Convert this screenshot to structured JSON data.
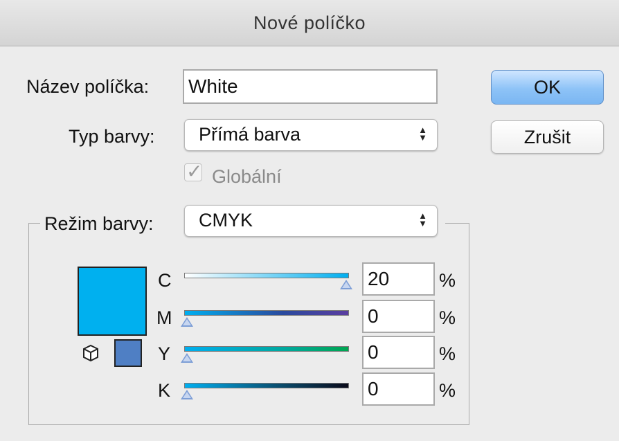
{
  "window": {
    "title": "Nové políčko"
  },
  "name_field": {
    "label": "Název políčka:",
    "value": "White"
  },
  "color_type": {
    "label": "Typ barvy:",
    "value": "Přímá barva"
  },
  "global_checkbox": {
    "label": "Globální",
    "checked": true,
    "enabled": false
  },
  "color_mode": {
    "label": "Režim barvy:",
    "value": "CMYK"
  },
  "buttons": {
    "ok": "OK",
    "cancel": "Zrušit"
  },
  "preview": {
    "color": "#00b0ef",
    "websafe_color": "#4f7fc4"
  },
  "channels": [
    {
      "label": "C",
      "value": "20",
      "percent": "%",
      "level": 1.0
    },
    {
      "label": "M",
      "value": "0",
      "percent": "%",
      "level": 0.0
    },
    {
      "label": "Y",
      "value": "0",
      "percent": "%",
      "level": 0.0
    },
    {
      "label": "K",
      "value": "0",
      "percent": "%",
      "level": 0.0
    }
  ],
  "icons": {
    "arrows": "updown-arrows-icon",
    "cube": "cube-icon",
    "check": "checkmark-icon"
  }
}
